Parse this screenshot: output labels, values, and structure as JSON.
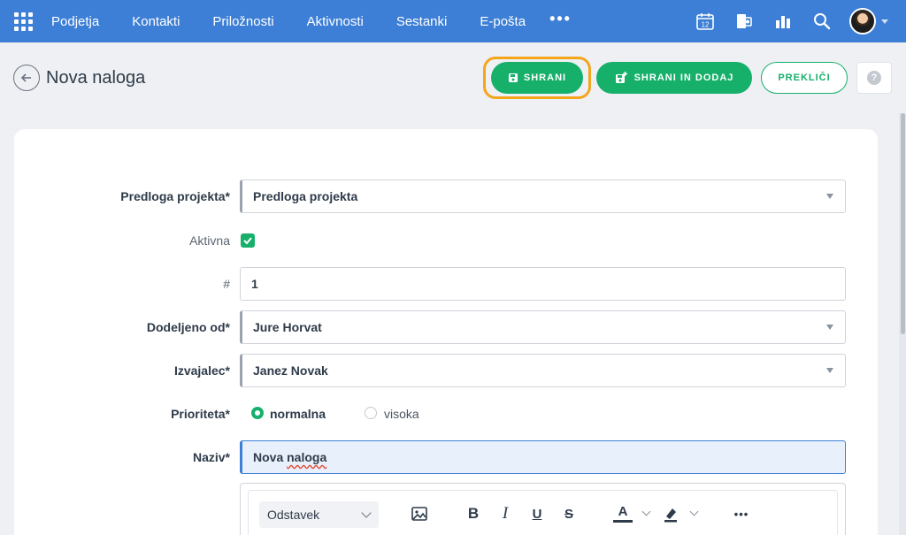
{
  "nav": {
    "items": [
      "Podjetja",
      "Kontakti",
      "Priložnosti",
      "Aktivnosti",
      "Sestanki",
      "E-pošta"
    ],
    "more": "•••",
    "calendar_day": "12",
    "icons": [
      "apps-grid-icon",
      "calendar-icon",
      "teams-icon",
      "reports-icon",
      "search-icon",
      "avatar"
    ]
  },
  "header": {
    "title": "Nova naloga",
    "save_label": "SHRANI",
    "save_add_label": "SHRANI IN DODAJ",
    "cancel_label": "PREKLIČI",
    "help_label": "?"
  },
  "form": {
    "template": {
      "label": "Predloga projekta*",
      "value": "Predloga projekta"
    },
    "active": {
      "label": "Aktivna",
      "checked": true
    },
    "number": {
      "label": "#",
      "value": "1"
    },
    "assigned_by": {
      "label": "Dodeljeno od*",
      "value": "Jure Horvat"
    },
    "assignee": {
      "label": "Izvajalec*",
      "value": "Janez Novak"
    },
    "priority": {
      "label": "Prioriteta*",
      "options": [
        "normalna",
        "visoka"
      ],
      "selected": "normalna"
    },
    "name": {
      "label": "Naziv*",
      "value_prefix": "Nova ",
      "value_misspelled": "naloga"
    },
    "editor": {
      "paragraph_label": "Odstavek",
      "bold": "B",
      "italic": "I",
      "underline": "U",
      "strike": "S",
      "font_color": "A",
      "more": "•••"
    }
  },
  "colors": {
    "nav": "#3d7fd6",
    "accent": "#16b06b",
    "highlight": "#f4a51c"
  }
}
